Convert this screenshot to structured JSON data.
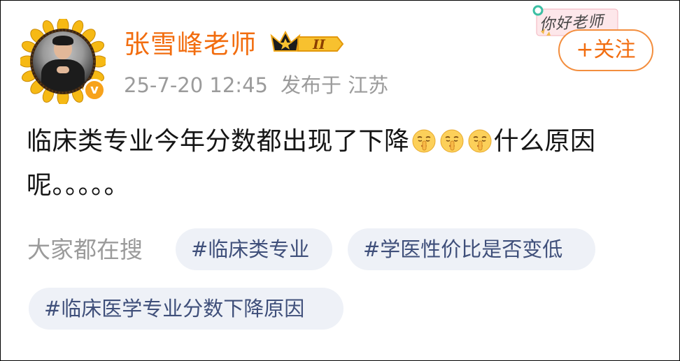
{
  "user": {
    "name": "张雪峰老师",
    "level_badge": "II",
    "verified_mark": "v",
    "timestamp": "25-7-20 12:45",
    "location": "发布于 江苏",
    "avatar_icon": "avatar-sunflower-frame"
  },
  "decoration": {
    "text": "你好老师"
  },
  "follow": {
    "label": "+关注"
  },
  "post": {
    "text_before_emoji": "临床类专业今年分数都出现了下降",
    "emoji": [
      "shush-face-icon",
      "shush-face-icon",
      "shush-face-icon"
    ],
    "text_after_emoji": "什么原因呢。。。。。"
  },
  "tags": {
    "label": "大家都在搜",
    "items": [
      "#临床类专业",
      "#学医性价比是否变低",
      "#临床医学专业分数下降原因"
    ]
  },
  "colors": {
    "name": "#f26d0f",
    "follow_border": "#f38e3e",
    "meta": "#9b9b9b",
    "tag_bg": "#eef1f7",
    "tag_text": "#3f4f7a"
  }
}
